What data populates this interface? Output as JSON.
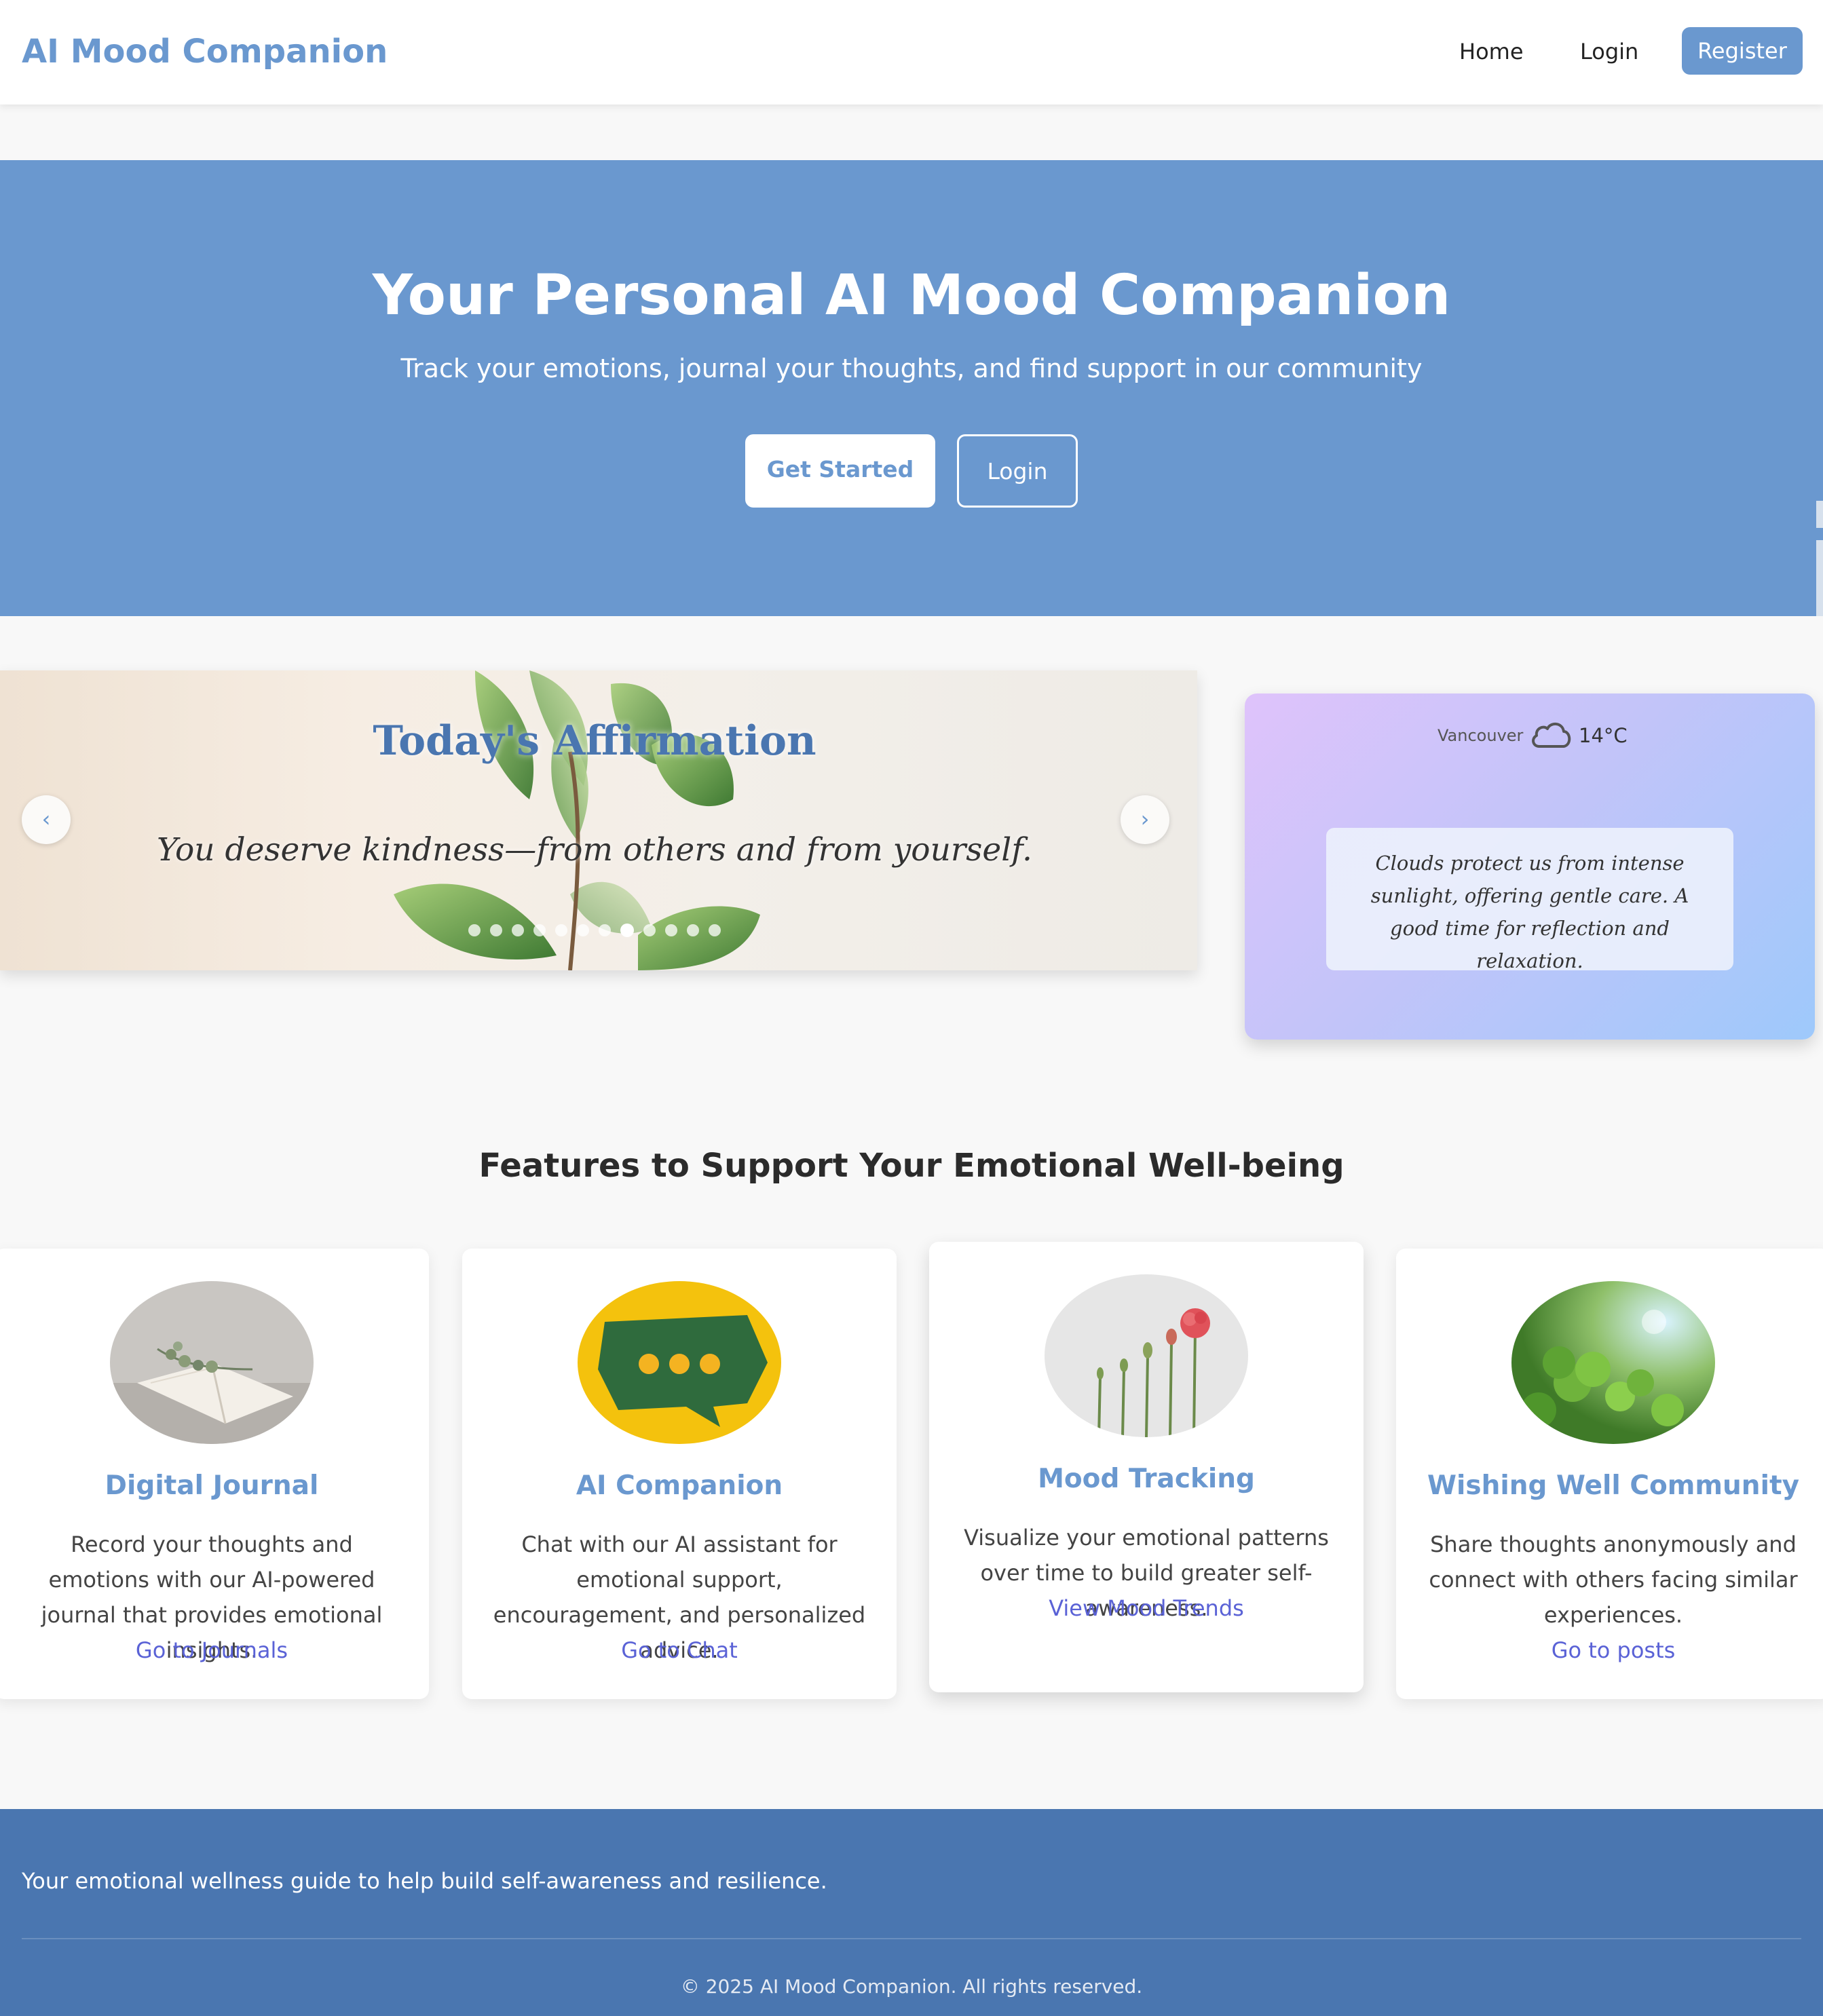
{
  "navbar": {
    "brand": "AI Mood Companion",
    "links": [
      {
        "label": "Home"
      },
      {
        "label": "Login"
      },
      {
        "label": "Register"
      }
    ]
  },
  "hero": {
    "title": "Your Personal AI Mood Companion",
    "subtitle": "Track your emotions, journal your thoughts, and find support in our community",
    "primary_button": "Get Started",
    "secondary_button": "Login"
  },
  "affirmation": {
    "title": "Today's Affirmation",
    "quote": "You deserve kindness—from others and from yourself.",
    "prev_icon": "‹",
    "next_icon": "›",
    "dot_count": 12,
    "active_dot": 8
  },
  "weather": {
    "city": "Vancouver",
    "icon": "cloud-icon",
    "temperature": "14°C",
    "message": "Clouds protect us from intense sunlight, offering gentle care. A good time for reflection and relaxation."
  },
  "features": {
    "title": "Features to Support Your Emotional Well-being",
    "cards": [
      {
        "title": "Digital Journal",
        "description": "Record your thoughts and emotions with our AI-powered journal that provides emotional insights.",
        "link": "Go to Journals"
      },
      {
        "title": "AI Companion",
        "description": "Chat with our AI assistant for emotional support, encouragement, and personalized advice.",
        "link": "Go to Chat"
      },
      {
        "title": "Mood Tracking",
        "description": "Visualize your emotional patterns over time to build greater self-awareness.",
        "link": "View Mood Trends"
      },
      {
        "title": "Wishing Well Community",
        "description": "Share thoughts anonymously and connect with others facing similar experiences.",
        "link": "Go to posts"
      }
    ]
  },
  "footer": {
    "tagline": "Your emotional wellness guide to help build self-awareness and resilience.",
    "copyright": "© 2025 AI Mood Companion. All rights reserved."
  },
  "colors": {
    "primary": "#6a98cf",
    "footer": "#4a76b0",
    "link": "#5a62d6"
  }
}
